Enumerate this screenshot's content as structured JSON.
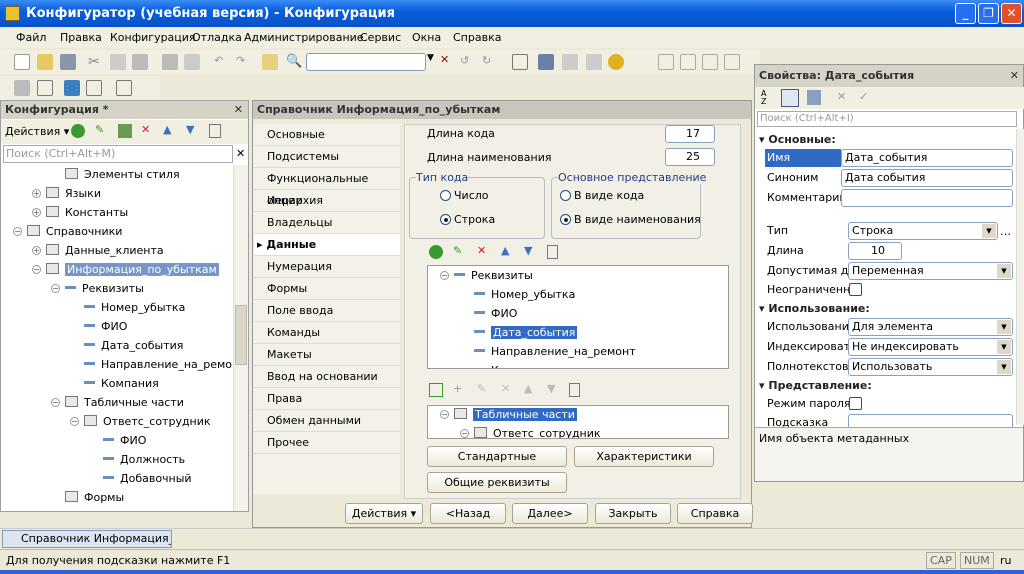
{
  "window": {
    "title": "Конфигуратор (учебная версия) - Конфигурация"
  },
  "menu": [
    "Файл",
    "Правка",
    "Конфигурация",
    "Отладка",
    "Администрирование",
    "Сервис",
    "Окна",
    "Справка"
  ],
  "left_panel": {
    "title": "Конфигурация *",
    "actions_label": "Действия",
    "search_placeholder": "Поиск (Ctrl+Alt+M)",
    "tree": [
      {
        "label": "Элементы стиля",
        "level": 2,
        "icon": "style-icon"
      },
      {
        "label": "Языки",
        "level": 1,
        "icon": "language-icon",
        "toggle": "+"
      },
      {
        "label": "Константы",
        "level": 1,
        "icon": "constant-icon",
        "toggle": "+"
      },
      {
        "label": "Справочники",
        "level": 0,
        "icon": "catalog-icon",
        "toggle": "-"
      },
      {
        "label": "Данные_клиента",
        "level": 1,
        "icon": "catalog-icon",
        "toggle": "+"
      },
      {
        "label": "Информация_по_убыткам",
        "level": 1,
        "icon": "catalog-icon",
        "toggle": "-",
        "selected": true
      },
      {
        "label": "Реквизиты",
        "level": 2,
        "icon": "attribute-icon",
        "toggle": "-"
      },
      {
        "label": "Номер_убытка",
        "level": 3,
        "icon": "attribute-icon"
      },
      {
        "label": "ФИО",
        "level": 3,
        "icon": "attribute-icon"
      },
      {
        "label": "Дата_события",
        "level": 3,
        "icon": "attribute-icon"
      },
      {
        "label": "Направление_на_ремонт",
        "level": 3,
        "icon": "attribute-icon"
      },
      {
        "label": "Компания",
        "level": 3,
        "icon": "attribute-icon"
      },
      {
        "label": "Табличные части",
        "level": 2,
        "icon": "table-icon",
        "toggle": "-"
      },
      {
        "label": "Ответс_сотрудник",
        "level": 3,
        "icon": "table-icon",
        "toggle": "-"
      },
      {
        "label": "ФИО",
        "level": 4,
        "icon": "attribute-icon"
      },
      {
        "label": "Должность",
        "level": 4,
        "icon": "attribute-icon"
      },
      {
        "label": "Добавочный",
        "level": 4,
        "icon": "attribute-icon"
      },
      {
        "label": "Формы",
        "level": 2,
        "icon": "form-icon"
      }
    ]
  },
  "editor": {
    "title": "Справочник Информация_по_убыткам",
    "nav": [
      "Основные",
      "Подсистемы",
      "Функциональные опции",
      "Иерархия",
      "Владельцы",
      "Данные",
      "Нумерация",
      "Формы",
      "Поле ввода",
      "Команды",
      "Макеты",
      "Ввод на основании",
      "Права",
      "Обмен данными",
      "Прочее"
    ],
    "active_nav": "Данные",
    "code_length_label": "Длина кода",
    "code_length": "17",
    "name_length_label": "Длина наименования",
    "name_length": "25",
    "code_type": {
      "title": "Тип кода",
      "options": [
        "Число",
        "Строка"
      ],
      "selected": "Строка"
    },
    "main_repr": {
      "title": "Основное представление",
      "options": [
        "В виде кода",
        "В виде наименования"
      ],
      "selected": "В виде наименования"
    },
    "attributes": [
      {
        "label": "Реквизиты",
        "level": 0
      },
      {
        "label": "Номер_убытка",
        "level": 1
      },
      {
        "label": "ФИО",
        "level": 1
      },
      {
        "label": "Дата_события",
        "level": 1,
        "selected": true
      },
      {
        "label": "Направление_на_ремонт",
        "level": 1
      },
      {
        "label": "Компания",
        "level": 1
      }
    ],
    "tabular": [
      {
        "label": "Табличные части",
        "level": 0,
        "selected": true
      },
      {
        "label": "Ответс_сотрудник",
        "level": 1
      }
    ],
    "buttons": {
      "std_attrs": "Стандартные реквизиты",
      "characteristics": "Характеристики",
      "common_attrs": "Общие реквизиты"
    },
    "footer": {
      "actions": "Действия",
      "back": "<Назад",
      "next": "Далее>",
      "close": "Закрыть",
      "help": "Справка"
    }
  },
  "properties": {
    "title": "Свойства: Дата_события",
    "search_placeholder": "Поиск (Ctrl+Alt+I)",
    "sections": {
      "basic": "Основные:",
      "usage": "Использование:",
      "view": "Представление:"
    },
    "name_label": "Имя",
    "name": "Дата_события",
    "synonym_label": "Синоним",
    "synonym": "Дата события",
    "comment_label": "Комментарий",
    "comment": "",
    "type_label": "Тип",
    "type": "Строка",
    "length_label": "Длина",
    "length": "10",
    "allowed_label": "Допустимая дл",
    "allowed": "Переменная",
    "unlimited_label": "Неограниченна",
    "unlimited": false,
    "use_label": "Использование",
    "use": "Для элемента",
    "index_label": "Индексировать",
    "index": "Не индексировать",
    "fulltext_label": "Полнотекстовь",
    "fulltext": "Использовать",
    "password_label": "Режим пароля",
    "password": false,
    "hint_label": "Подсказка",
    "hint": "",
    "description": "Имя объекта метаданных"
  },
  "taskbar": {
    "window_tab": "Справочник Информация_п..."
  },
  "status": {
    "hint": "Для получения подсказки нажмите F1",
    "cap": "CAP",
    "num": "NUM",
    "lang": "ru"
  }
}
